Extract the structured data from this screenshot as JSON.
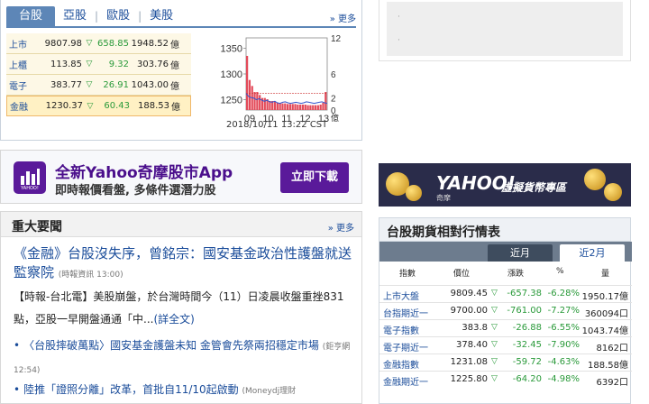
{
  "market": {
    "tabs": [
      "台股",
      "亞股",
      "歐股",
      "美股"
    ],
    "more": "» 更多",
    "quotes": [
      {
        "name": "上市",
        "price": "9807.98",
        "change": "658.85",
        "volume": "1948.52",
        "unit": "億"
      },
      {
        "name": "上櫃",
        "price": "113.85",
        "change": "9.32",
        "volume": "303.76",
        "unit": "億"
      },
      {
        "name": "電子",
        "price": "383.77",
        "change": "26.91",
        "volume": "1043.00",
        "unit": "億"
      },
      {
        "name": "金融",
        "price": "1230.37",
        "change": "60.43",
        "volume": "188.53",
        "unit": "億"
      }
    ],
    "timestamp": "2018/10/11 13:22 CST"
  },
  "chart_data": {
    "type": "line",
    "title": "",
    "xlabel": "",
    "ylabel": "",
    "x_ticks": [
      "09",
      "10",
      "11",
      "12",
      "13"
    ],
    "y_ticks_left": [
      1250,
      1300,
      1350
    ],
    "y_ticks_right": [
      "0",
      "2",
      "6",
      "12"
    ],
    "right_unit": "億",
    "ylim": [
      1230,
      1370
    ],
    "series": [
      {
        "values": [
          1262,
          1256,
          1254,
          1253,
          1250,
          1252,
          1249,
          1247,
          1249,
          1246,
          1245,
          1247,
          1244,
          1243,
          1245,
          1246,
          1244,
          1243,
          1244,
          1245,
          1244,
          1243,
          1244,
          1246,
          1245,
          1244,
          1243,
          1244,
          1245,
          1246,
          1244,
          1243
        ]
      }
    ],
    "volume": [
      9,
      5,
      4,
      3,
      3,
      2.5,
      2,
      2,
      1.8,
      1.5,
      1.5,
      1.4,
      1.2,
      1.2,
      1.1,
      1.1,
      1,
      1,
      1,
      1,
      0.9,
      0.9,
      0.9,
      0.9,
      0.8,
      0.8,
      0.8,
      0.8,
      0.8,
      0.9,
      1.2,
      3
    ],
    "colors": {
      "price": "#3355cc",
      "volume": "#e34b5a",
      "ref": "#cc3333"
    }
  },
  "app_banner": {
    "logo_text": "YAHOO!",
    "title": "全新Yahoo奇摩股市App",
    "subtitle": "即時報價看盤, 多條件選潛力股",
    "button": "立即下載"
  },
  "news": {
    "title": "重大要聞",
    "more": "» 更多",
    "headline": "《金融》台股沒失序，曾銘宗：國安基金政治性護盤就送監察院",
    "headline_source": "(時報資訊 13:00)",
    "summary": "【時報-台北電】美股崩盤，於台灣時間今（11）日凌晨收盤重挫831點，亞股一早開盤通通「中...",
    "summary_link": "(詳全文)",
    "items": [
      {
        "text": "〈台股摔破萬點〉國安基金護盤未知 金管會先祭兩招穩定市場",
        "source": "(鉅亨網 12:54)"
      },
      {
        "text": "陸推「證照分離」改革，首批自11/10起啟動",
        "source": "(Moneydj理財"
      }
    ]
  },
  "right_ad": {
    "dots": [
      "·",
      "·"
    ]
  },
  "yahoo_banner": {
    "logo": "YAHOO!",
    "sub": "奇摩",
    "caption": "虛擬貨幣專區"
  },
  "futures": {
    "title": "台股期貨相對行情表",
    "tabs": [
      "近月",
      "近2月"
    ],
    "columns": [
      "指數",
      "價位",
      "漲跌",
      "%",
      "量"
    ],
    "rows": [
      {
        "name": "上市大盤",
        "price": "9809.45",
        "change": "-657.38",
        "pct": "-6.28%",
        "vol": "1950.17億"
      },
      {
        "name": "台指期近一",
        "price": "9700.00",
        "change": "-761.00",
        "pct": "-7.27%",
        "vol": "360094口"
      },
      {
        "name": "電子指數",
        "price": "383.8",
        "change": "-26.88",
        "pct": "-6.55%",
        "vol": "1043.74億"
      },
      {
        "name": "電子期近一",
        "price": "378.40",
        "change": "-32.45",
        "pct": "-7.90%",
        "vol": "8162口"
      },
      {
        "name": "金融指數",
        "price": "1231.08",
        "change": "-59.72",
        "pct": "-4.63%",
        "vol": "188.58億"
      },
      {
        "name": "金融期近一",
        "price": "1225.80",
        "change": "-64.20",
        "pct": "-4.98%",
        "vol": "6392口"
      }
    ]
  }
}
